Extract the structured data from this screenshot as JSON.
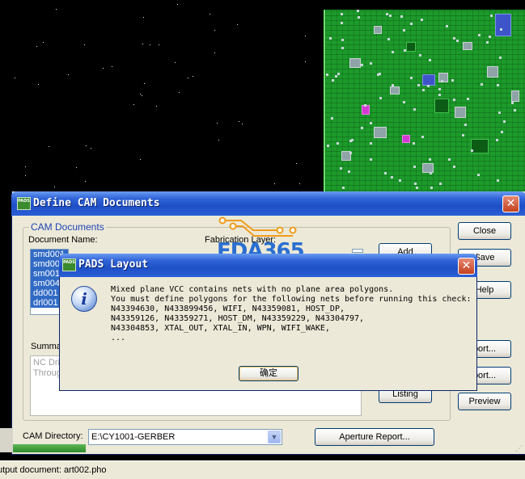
{
  "main_window": {
    "title": "Define CAM Documents",
    "close_glyph": "✕",
    "icon_name": "pads-app-icon",
    "icon_text": "PADS",
    "group_label": "CAM Documents",
    "document_name_label": "Document Name:",
    "fabrication_layer_label": "Fabrication Layer:",
    "documents": [
      "smd001",
      "smd00",
      "sm001",
      "sm004",
      "dd001",
      "drl001"
    ],
    "summary_label": "Summa",
    "summary_lines": [
      "NC Dri",
      "Throug"
    ],
    "cam_directory_label": "CAM Directory:",
    "cam_directory_value": "E:\\CY1001-GERBER",
    "buttons": {
      "close": "Close",
      "add": "Add",
      "save": "Save",
      "help": "Help",
      "report1": "port...",
      "report2": "port...",
      "listing": "Listing",
      "preview": "Preview",
      "aperture_report": "Aperture Report..."
    }
  },
  "message_box": {
    "title": "PADS Layout",
    "icon_name": "info-icon",
    "icon_glyph": "i",
    "close_glyph": "✕",
    "lines": [
      "Mixed plane VCC contains nets with no plane area polygons.",
      "You must define polygons for the following nets before running this check:",
      "N43394630, N433899456, WIFI, N43359081, HOST_DP,",
      "N43359126, N43359271, HOST_DM, N43359229, N43304797,",
      "N43304853, XTAL_OUT, XTAL_IN, WPN, WIFI_WAKE,",
      "..."
    ],
    "ok_label": "确定"
  },
  "watermark": {
    "text": "EDA365"
  },
  "status_bar": {
    "text": "utput document: art002.pho"
  },
  "colors": {
    "titlebar": "#2f63d8",
    "selection": "#316ac5",
    "pcb_green": "#1c9a2a",
    "watermark": "#2a6fd0",
    "watermark_trace": "#f09b1c"
  }
}
